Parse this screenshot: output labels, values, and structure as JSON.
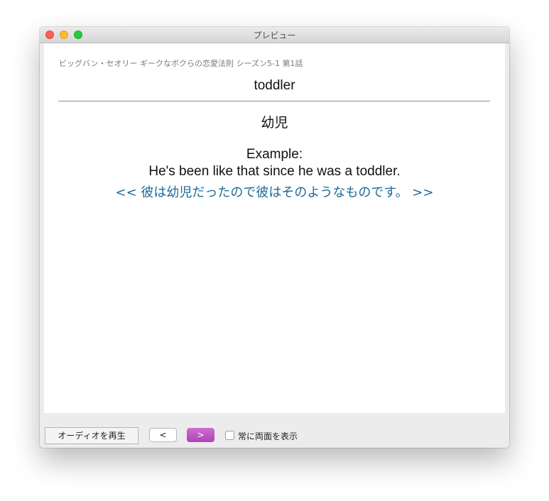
{
  "window": {
    "title": "プレビュー"
  },
  "card": {
    "source": "ビッグバン・セオリー ギークなボクらの恋愛法則 シーズン5-1 第1話",
    "word": "toddler",
    "meaning": "幼児",
    "example_label": "Example:",
    "example_en": "He's been like that since he was a toddler.",
    "example_ja": "<< 彼は幼児だったので彼はそのようなものです。 >>"
  },
  "toolbar": {
    "play_audio_label": "オーディオを再生",
    "prev_label": "<",
    "next_label": ">",
    "always_show_both_label": "常に両面を表示",
    "always_show_both_checked": false
  },
  "colors": {
    "translation": "#1d6a9a",
    "next_button": "#b043b5"
  }
}
